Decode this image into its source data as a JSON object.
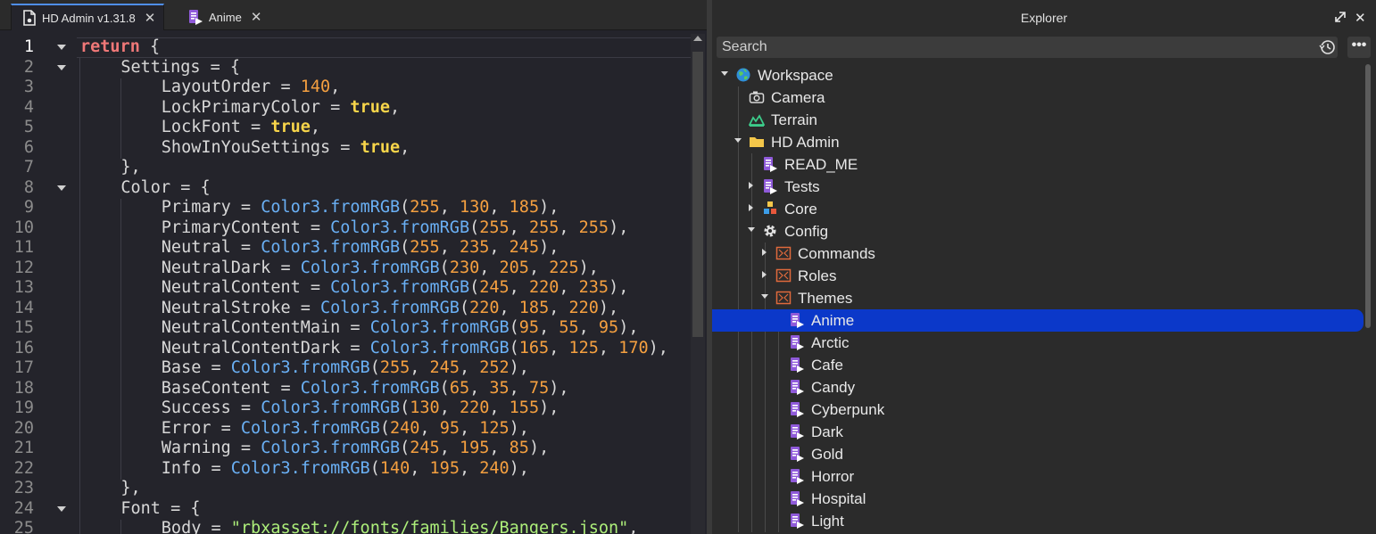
{
  "tabs": [
    {
      "label": "HD Admin v1.31.8",
      "icon": "document-icon",
      "active": true
    },
    {
      "label": "Anime",
      "icon": "script-icon",
      "active": false
    }
  ],
  "code_lines": [
    {
      "num": "1",
      "fold": true,
      "indent": 0,
      "tokens": [
        [
          "k",
          "return"
        ],
        [
          "p",
          " {"
        ]
      ]
    },
    {
      "num": "2",
      "fold": true,
      "indent": 1,
      "tokens": [
        [
          "p",
          "Settings = {"
        ]
      ]
    },
    {
      "num": "3",
      "fold": false,
      "indent": 2,
      "tokens": [
        [
          "p",
          "LayoutOrder = "
        ],
        [
          "n",
          "140"
        ],
        [
          "p",
          ","
        ]
      ]
    },
    {
      "num": "4",
      "fold": false,
      "indent": 2,
      "tokens": [
        [
          "p",
          "LockPrimaryColor = "
        ],
        [
          "b",
          "true"
        ],
        [
          "p",
          ","
        ]
      ]
    },
    {
      "num": "5",
      "fold": false,
      "indent": 2,
      "tokens": [
        [
          "p",
          "LockFont = "
        ],
        [
          "b",
          "true"
        ],
        [
          "p",
          ","
        ]
      ]
    },
    {
      "num": "6",
      "fold": false,
      "indent": 2,
      "tokens": [
        [
          "p",
          "ShowInYouSettings = "
        ],
        [
          "b",
          "true"
        ],
        [
          "p",
          ","
        ]
      ]
    },
    {
      "num": "7",
      "fold": false,
      "indent": 1,
      "tokens": [
        [
          "p",
          "},"
        ]
      ]
    },
    {
      "num": "8",
      "fold": true,
      "indent": 1,
      "tokens": [
        [
          "p",
          "Color = {"
        ]
      ]
    },
    {
      "num": "9",
      "fold": false,
      "indent": 2,
      "tokens": [
        [
          "p",
          "Primary = "
        ],
        [
          "f",
          "Color3.fromRGB"
        ],
        [
          "p",
          "("
        ],
        [
          "n",
          "255"
        ],
        [
          "p",
          ", "
        ],
        [
          "n",
          "130"
        ],
        [
          "p",
          ", "
        ],
        [
          "n",
          "185"
        ],
        [
          "p",
          "),"
        ]
      ]
    },
    {
      "num": "10",
      "fold": false,
      "indent": 2,
      "tokens": [
        [
          "p",
          "PrimaryContent = "
        ],
        [
          "f",
          "Color3.fromRGB"
        ],
        [
          "p",
          "("
        ],
        [
          "n",
          "255"
        ],
        [
          "p",
          ", "
        ],
        [
          "n",
          "255"
        ],
        [
          "p",
          ", "
        ],
        [
          "n",
          "255"
        ],
        [
          "p",
          "),"
        ]
      ]
    },
    {
      "num": "11",
      "fold": false,
      "indent": 2,
      "tokens": [
        [
          "p",
          "Neutral = "
        ],
        [
          "f",
          "Color3.fromRGB"
        ],
        [
          "p",
          "("
        ],
        [
          "n",
          "255"
        ],
        [
          "p",
          ", "
        ],
        [
          "n",
          "235"
        ],
        [
          "p",
          ", "
        ],
        [
          "n",
          "245"
        ],
        [
          "p",
          "),"
        ]
      ]
    },
    {
      "num": "12",
      "fold": false,
      "indent": 2,
      "tokens": [
        [
          "p",
          "NeutralDark = "
        ],
        [
          "f",
          "Color3.fromRGB"
        ],
        [
          "p",
          "("
        ],
        [
          "n",
          "230"
        ],
        [
          "p",
          ", "
        ],
        [
          "n",
          "205"
        ],
        [
          "p",
          ", "
        ],
        [
          "n",
          "225"
        ],
        [
          "p",
          "),"
        ]
      ]
    },
    {
      "num": "13",
      "fold": false,
      "indent": 2,
      "tokens": [
        [
          "p",
          "NeutralContent = "
        ],
        [
          "f",
          "Color3.fromRGB"
        ],
        [
          "p",
          "("
        ],
        [
          "n",
          "245"
        ],
        [
          "p",
          ", "
        ],
        [
          "n",
          "220"
        ],
        [
          "p",
          ", "
        ],
        [
          "n",
          "235"
        ],
        [
          "p",
          "),"
        ]
      ]
    },
    {
      "num": "14",
      "fold": false,
      "indent": 2,
      "tokens": [
        [
          "p",
          "NeutralStroke = "
        ],
        [
          "f",
          "Color3.fromRGB"
        ],
        [
          "p",
          "("
        ],
        [
          "n",
          "220"
        ],
        [
          "p",
          ", "
        ],
        [
          "n",
          "185"
        ],
        [
          "p",
          ", "
        ],
        [
          "n",
          "220"
        ],
        [
          "p",
          "),"
        ]
      ]
    },
    {
      "num": "15",
      "fold": false,
      "indent": 2,
      "tokens": [
        [
          "p",
          "NeutralContentMain = "
        ],
        [
          "f",
          "Color3.fromRGB"
        ],
        [
          "p",
          "("
        ],
        [
          "n",
          "95"
        ],
        [
          "p",
          ", "
        ],
        [
          "n",
          "55"
        ],
        [
          "p",
          ", "
        ],
        [
          "n",
          "95"
        ],
        [
          "p",
          "),"
        ]
      ]
    },
    {
      "num": "16",
      "fold": false,
      "indent": 2,
      "tokens": [
        [
          "p",
          "NeutralContentDark = "
        ],
        [
          "f",
          "Color3.fromRGB"
        ],
        [
          "p",
          "("
        ],
        [
          "n",
          "165"
        ],
        [
          "p",
          ", "
        ],
        [
          "n",
          "125"
        ],
        [
          "p",
          ", "
        ],
        [
          "n",
          "170"
        ],
        [
          "p",
          "),"
        ]
      ]
    },
    {
      "num": "17",
      "fold": false,
      "indent": 2,
      "tokens": [
        [
          "p",
          "Base = "
        ],
        [
          "f",
          "Color3.fromRGB"
        ],
        [
          "p",
          "("
        ],
        [
          "n",
          "255"
        ],
        [
          "p",
          ", "
        ],
        [
          "n",
          "245"
        ],
        [
          "p",
          ", "
        ],
        [
          "n",
          "252"
        ],
        [
          "p",
          "),"
        ]
      ]
    },
    {
      "num": "18",
      "fold": false,
      "indent": 2,
      "tokens": [
        [
          "p",
          "BaseContent = "
        ],
        [
          "f",
          "Color3.fromRGB"
        ],
        [
          "p",
          "("
        ],
        [
          "n",
          "65"
        ],
        [
          "p",
          ", "
        ],
        [
          "n",
          "35"
        ],
        [
          "p",
          ", "
        ],
        [
          "n",
          "75"
        ],
        [
          "p",
          "),"
        ]
      ]
    },
    {
      "num": "19",
      "fold": false,
      "indent": 2,
      "tokens": [
        [
          "p",
          "Success = "
        ],
        [
          "f",
          "Color3.fromRGB"
        ],
        [
          "p",
          "("
        ],
        [
          "n",
          "130"
        ],
        [
          "p",
          ", "
        ],
        [
          "n",
          "220"
        ],
        [
          "p",
          ", "
        ],
        [
          "n",
          "155"
        ],
        [
          "p",
          "),"
        ]
      ]
    },
    {
      "num": "20",
      "fold": false,
      "indent": 2,
      "tokens": [
        [
          "p",
          "Error = "
        ],
        [
          "f",
          "Color3.fromRGB"
        ],
        [
          "p",
          "("
        ],
        [
          "n",
          "240"
        ],
        [
          "p",
          ", "
        ],
        [
          "n",
          "95"
        ],
        [
          "p",
          ", "
        ],
        [
          "n",
          "125"
        ],
        [
          "p",
          "),"
        ]
      ]
    },
    {
      "num": "21",
      "fold": false,
      "indent": 2,
      "tokens": [
        [
          "p",
          "Warning = "
        ],
        [
          "f",
          "Color3.fromRGB"
        ],
        [
          "p",
          "("
        ],
        [
          "n",
          "245"
        ],
        [
          "p",
          ", "
        ],
        [
          "n",
          "195"
        ],
        [
          "p",
          ", "
        ],
        [
          "n",
          "85"
        ],
        [
          "p",
          "),"
        ]
      ]
    },
    {
      "num": "22",
      "fold": false,
      "indent": 2,
      "tokens": [
        [
          "p",
          "Info = "
        ],
        [
          "f",
          "Color3.fromRGB"
        ],
        [
          "p",
          "("
        ],
        [
          "n",
          "140"
        ],
        [
          "p",
          ", "
        ],
        [
          "n",
          "195"
        ],
        [
          "p",
          ", "
        ],
        [
          "n",
          "240"
        ],
        [
          "p",
          "),"
        ]
      ]
    },
    {
      "num": "23",
      "fold": false,
      "indent": 1,
      "tokens": [
        [
          "p",
          "},"
        ]
      ]
    },
    {
      "num": "24",
      "fold": true,
      "indent": 1,
      "tokens": [
        [
          "p",
          "Font = {"
        ]
      ]
    },
    {
      "num": "25",
      "fold": false,
      "indent": 2,
      "tokens": [
        [
          "p",
          "Body = "
        ],
        [
          "s",
          "\"rbxasset://fonts/families/Bangers.json\""
        ],
        [
          "p",
          ","
        ]
      ]
    }
  ],
  "explorer": {
    "title": "Explorer",
    "search_placeholder": "Search",
    "tree": [
      {
        "label": "Workspace",
        "depth": 0,
        "expander": "down",
        "icon": "globe-icon"
      },
      {
        "label": "Camera",
        "depth": 1,
        "expander": "none",
        "icon": "camera-icon"
      },
      {
        "label": "Terrain",
        "depth": 1,
        "expander": "none",
        "icon": "terrain-icon"
      },
      {
        "label": "HD Admin",
        "depth": 1,
        "expander": "down",
        "icon": "folder-icon"
      },
      {
        "label": "READ_ME",
        "depth": 2,
        "expander": "none",
        "icon": "module-script-icon"
      },
      {
        "label": "Tests",
        "depth": 2,
        "expander": "right",
        "icon": "module-script-icon"
      },
      {
        "label": "Core",
        "depth": 2,
        "expander": "right",
        "icon": "blocks-icon"
      },
      {
        "label": "Config",
        "depth": 2,
        "expander": "down",
        "icon": "gear-icon"
      },
      {
        "label": "Commands",
        "depth": 3,
        "expander": "right",
        "icon": "configuration-icon"
      },
      {
        "label": "Roles",
        "depth": 3,
        "expander": "right",
        "icon": "configuration-icon"
      },
      {
        "label": "Themes",
        "depth": 3,
        "expander": "down",
        "icon": "configuration-icon"
      },
      {
        "label": "Anime",
        "depth": 4,
        "expander": "none",
        "icon": "module-script-icon",
        "selected": true
      },
      {
        "label": "Arctic",
        "depth": 4,
        "expander": "none",
        "icon": "module-script-icon"
      },
      {
        "label": "Cafe",
        "depth": 4,
        "expander": "none",
        "icon": "module-script-icon"
      },
      {
        "label": "Candy",
        "depth": 4,
        "expander": "none",
        "icon": "module-script-icon"
      },
      {
        "label": "Cyberpunk",
        "depth": 4,
        "expander": "none",
        "icon": "module-script-icon"
      },
      {
        "label": "Dark",
        "depth": 4,
        "expander": "none",
        "icon": "module-script-icon"
      },
      {
        "label": "Gold",
        "depth": 4,
        "expander": "none",
        "icon": "module-script-icon"
      },
      {
        "label": "Horror",
        "depth": 4,
        "expander": "none",
        "icon": "module-script-icon"
      },
      {
        "label": "Hospital",
        "depth": 4,
        "expander": "none",
        "icon": "module-script-icon"
      },
      {
        "label": "Light",
        "depth": 4,
        "expander": "none",
        "icon": "module-script-icon"
      }
    ]
  },
  "colors": {
    "selection": "#0b38c9",
    "keyword": "#f07878",
    "boolean": "#f7d54a",
    "number": "#f5a040",
    "function": "#6ab0f5",
    "string": "#adef7a"
  }
}
